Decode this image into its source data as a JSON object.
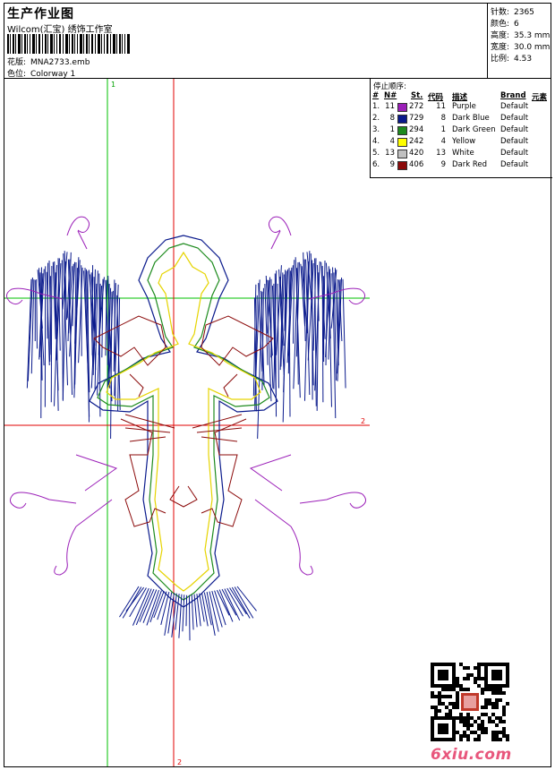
{
  "header": {
    "title": "生产作业图",
    "studio": "Wilcom(汇宝) 绣饰工作室",
    "design_label": "花版:",
    "design_value": "MNA2733.emb",
    "colorway_label": "色位:",
    "colorway_value": "Colorway 1"
  },
  "stats": {
    "stitches_label": "针数:",
    "stitches": "2365",
    "colors_label": "颜色:",
    "colors": "6",
    "height_label": "高度:",
    "height": "35.3 mm",
    "width_label": "宽度:",
    "width": "30.0 mm",
    "ratio_label": "比例:",
    "ratio": "4.53"
  },
  "stop_sequence": {
    "title": "停止顺序:",
    "headers": [
      "#",
      "N#",
      "St.",
      "代码",
      "描述",
      "Brand",
      "元素"
    ],
    "rows": [
      {
        "idx": "1.",
        "n": "11",
        "color": "#9b1fb8",
        "st": "272",
        "code": "11",
        "desc": "Purple",
        "brand": "Default"
      },
      {
        "idx": "2.",
        "n": "8",
        "color": "#0a1a8c",
        "st": "729",
        "code": "8",
        "desc": "Dark Blue",
        "brand": "Default"
      },
      {
        "idx": "3.",
        "n": "1",
        "color": "#1e8b1e",
        "st": "294",
        "code": "1",
        "desc": "Dark Green",
        "brand": "Default"
      },
      {
        "idx": "4.",
        "n": "4",
        "color": "#ffff00",
        "st": "242",
        "code": "4",
        "desc": "Yellow",
        "brand": "Default"
      },
      {
        "idx": "5.",
        "n": "13",
        "color": "#c0c0c0",
        "st": "420",
        "code": "13",
        "desc": "White",
        "brand": "Default"
      },
      {
        "idx": "6.",
        "n": "9",
        "color": "#8b0a0a",
        "st": "406",
        "code": "9",
        "desc": "Dark Red",
        "brand": "Default"
      }
    ]
  },
  "guides": {
    "v1": "1",
    "h2": "2",
    "v2": "2"
  },
  "watermark": "6xiu.com",
  "colors": {
    "guide_green": "#00c000",
    "guide_red": "#e00000",
    "purple": "#9b1fb8",
    "blue": "#0a1a8c",
    "green": "#1e8b1e",
    "yellow": "#ffff00",
    "darkred": "#8b0a0a"
  }
}
